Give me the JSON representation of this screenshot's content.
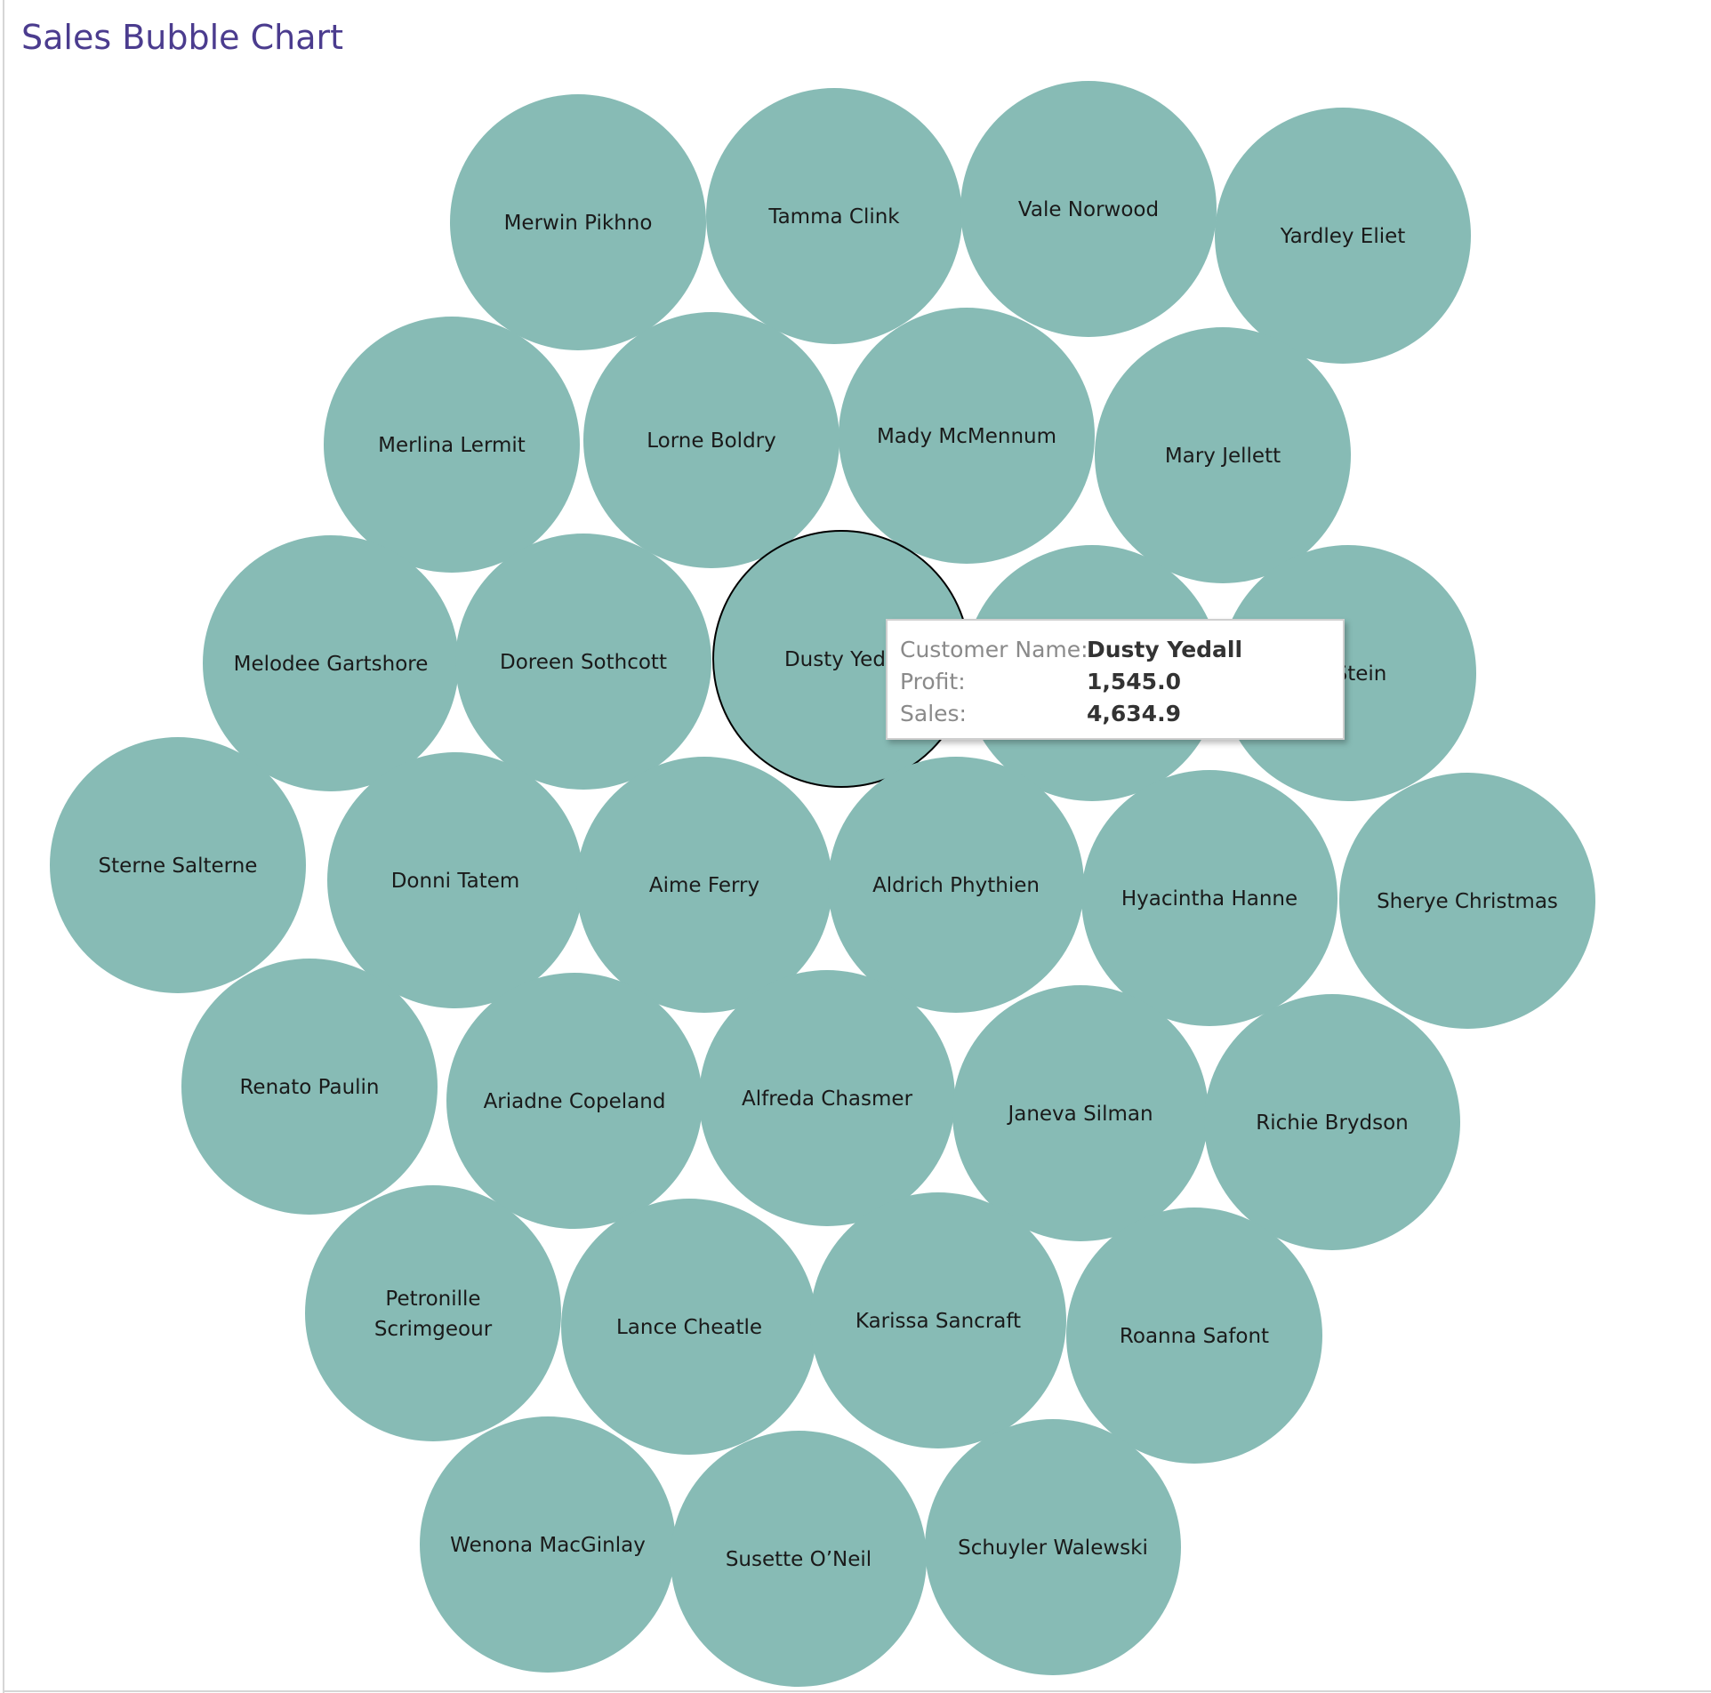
{
  "title": "Sales Bubble Chart",
  "colors": {
    "bubble": "#87bbb5",
    "title": "#4b3c8e",
    "highlight_stroke": "#000000"
  },
  "tooltip": {
    "customer_key": "Customer Name:",
    "customer_value": "Dusty Yedall",
    "profit_key": "Profit:",
    "profit_value": "1,545.0",
    "sales_key": "Sales:",
    "sales_value": "4,634.9"
  },
  "chart_data": {
    "type": "bubble",
    "size_measure": "Sales",
    "label_field": "Customer Name",
    "highlighted": "Dusty Yedall",
    "bubbles": [
      {
        "label": "Merwin Pikhno"
      },
      {
        "label": "Tamma Clink"
      },
      {
        "label": "Vale Norwood"
      },
      {
        "label": "Yardley Eliet"
      },
      {
        "label": "Merlina Lermit"
      },
      {
        "label": "Lorne Boldry"
      },
      {
        "label": "Mady McMennum"
      },
      {
        "label": "Mary Jellett"
      },
      {
        "label": "Melodee Gartshore"
      },
      {
        "label": "Doreen Sothcott"
      },
      {
        "label": "Dusty Yedall",
        "display_label": "Dusty Yeda",
        "sales": 4634.9,
        "profit": 1545.0
      },
      {
        "label": "",
        "display_label": ""
      },
      {
        "label": "",
        "display_label": "Stein"
      },
      {
        "label": "Sterne Salterne"
      },
      {
        "label": "Donni Tatem"
      },
      {
        "label": "Aime Ferry"
      },
      {
        "label": "Aldrich Phythien"
      },
      {
        "label": "Hyacintha Hanne"
      },
      {
        "label": "Sherye Christmas"
      },
      {
        "label": "Renato Paulin"
      },
      {
        "label": "Ariadne Copeland"
      },
      {
        "label": "Alfreda Chasmer"
      },
      {
        "label": "Janeva Silman"
      },
      {
        "label": "Richie Brydson"
      },
      {
        "label": "Petronille Scrimgeour",
        "lines": [
          "Petronille",
          "Scrimgeour"
        ]
      },
      {
        "label": "Lance Cheatle"
      },
      {
        "label": "Karissa Sancraft"
      },
      {
        "label": "Roanna Safont"
      },
      {
        "label": "Wenona MacGinlay"
      },
      {
        "label": "Susette O'Neil",
        "display_label": "Susette O’Neil"
      },
      {
        "label": "Schuyler Walewski"
      }
    ]
  }
}
